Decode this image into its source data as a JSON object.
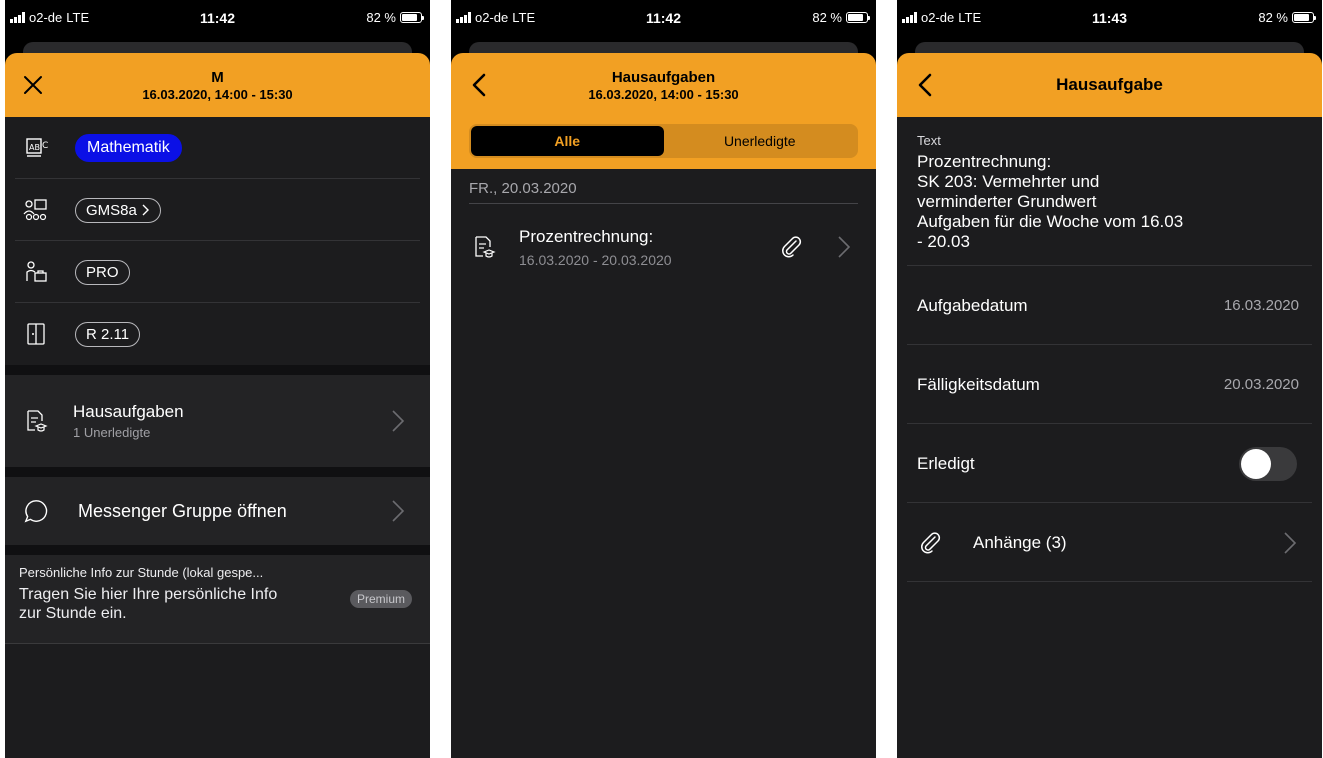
{
  "status_bars": [
    {
      "carrier": "o2-de",
      "network": "LTE",
      "time": "11:42",
      "battery": "82 %",
      "battery_level": 0.82
    },
    {
      "carrier": "o2-de",
      "network": "LTE",
      "time": "11:42",
      "battery": "82 %",
      "battery_level": 0.82
    },
    {
      "carrier": "o2-de",
      "network": "LTE",
      "time": "11:43",
      "battery": "82 %",
      "battery_level": 0.82
    }
  ],
  "lesson": {
    "header": {
      "title": "M",
      "subtitle": "16.03.2020, 14:00 - 15:30",
      "left_icon": "close-icon"
    },
    "subject": "Mathematik",
    "subject_color": "#0b10e6",
    "class_name": "GMS8a",
    "teacher": "PRO",
    "room": "R 2.11",
    "homework": {
      "title": "Hausaufgaben",
      "subtitle": "1 Unerledigte"
    },
    "messenger": {
      "title": "Messenger Gruppe öffnen"
    },
    "notes": {
      "caption": "Persönliche Info zur Stunde (lokal gespe...",
      "body": "Tragen Sie hier Ihre persönliche Info zur Stunde ein.",
      "badge": "Premium"
    }
  },
  "homework_list": {
    "header": {
      "title": "Hausaufgaben",
      "subtitle": "16.03.2020, 14:00 - 15:30",
      "left_icon": "back-chevron-icon"
    },
    "segments": [
      "Alle",
      "Unerledigte"
    ],
    "selected_segment": "Alle",
    "date_header": "FR., 20.03.2020",
    "items": [
      {
        "title": "Prozentrechnung:",
        "dates": "16.03.2020 - 20.03.2020",
        "has_attachment": true
      }
    ]
  },
  "homework_detail": {
    "header": {
      "title": "Hausaufgabe",
      "left_icon": "back-chevron-icon"
    },
    "text_caption": "Text",
    "text_lines": [
      "Prozentrechnung:",
      "SK 203: Vermehrter und",
      "verminderter Grundwert",
      "Aufgaben für die Woche vom 16.03",
      "- 20.03"
    ],
    "assigned_label": "Aufgabedatum",
    "assigned_value": "16.03.2020",
    "due_label": "Fälligkeitsdatum",
    "due_value": "20.03.2020",
    "done_label": "Erledigt",
    "done": false,
    "attachments_label": "Anhänge (3)"
  },
  "colors": {
    "accent": "#f2a023",
    "background": "#000000",
    "sheet": "#1c1c1e",
    "card": "#232325"
  }
}
